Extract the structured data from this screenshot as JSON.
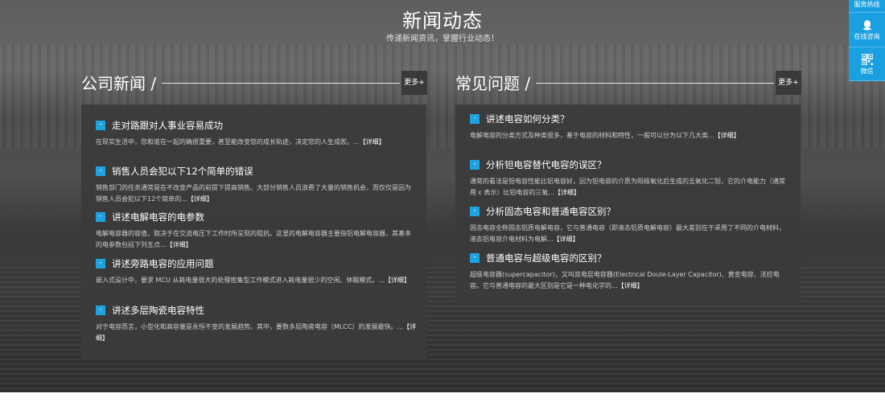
{
  "header": {
    "title": "新闻动态",
    "subtitle": "传递新闻资讯，掌握行业动态！"
  },
  "company_news": {
    "title": "公司新闻",
    "slash": "/",
    "more": "更多+",
    "badge": "-",
    "items": [
      {
        "title": "走对路跟对人事业容易成功",
        "desc": "在现实生活中，您和谁在一起的确很重要，甚至能改变您的成长轨迹，决定您的人生成败。...",
        "detail": "【详细】"
      },
      {
        "title": "销售人员会犯以下12个简单的错误",
        "desc": "销售部门的任务通常是在不改变产品的前提下提高销售。大部分销售人员浪费了大量的销售机会，而仅仅是因为销售人员会犯以下12个简单的...",
        "detail": "【详细】"
      },
      {
        "title": "讲述电解电容的电参数",
        "desc": "电解电容器的容值，取决于在交流电压下工作时所呈现的阻抗。这里的电解电容器主要指铝电解电容器，其基本的电参数包括下列五点...",
        "detail": "【详细】"
      },
      {
        "title": "讲述旁路电容的应用问题",
        "desc": "嵌入式设计中，要求 MCU 从耗电量很大的处理密集型工作模式进入耗电量很少的空闲、休眠模式。...",
        "detail": "【详细】"
      },
      {
        "title": "讲述多层陶瓷电容特性",
        "desc": "对于电容而言，小型化和高容量是永恒不变的发展趋势。其中，要数多层陶瓷电容（MLCC）的发展最快。...",
        "detail": "【详细】"
      }
    ]
  },
  "faq": {
    "title": "常见问题",
    "slash": "/",
    "more": "更多+",
    "badge": "-",
    "items": [
      {
        "title": "讲述电容如何分类？",
        "desc": "电解电容的分类方式及种类很多，基于电容的材料和特性，一般可以分为以下几大类...",
        "detail": "【详细】"
      },
      {
        "title": "分析钽电容替代电容的误区？",
        "desc": "通常的看法是钽电容性能比铝电容好，因为钽电容的介质为阳极氧化后生成的五氧化二钽，它的介电能力（通常用 ε 表示）比铝电容的三氧...",
        "detail": "【详细】"
      },
      {
        "title": "分析固态电容和普通电容区别？",
        "desc": "固态电容全称固态铝质电解电容，它与普通电容（即液态铝质电解电容）最大差别在于采用了不同的介电材料，液态铝电容介电材料为电解...",
        "detail": "【详细】"
      },
      {
        "title": "普通电容与超级电容的区别？",
        "desc": "超级电容器(supercapacitor)，又叫双电层电容器(Electrical Doule-Layer Capacitor)、黄金电容、法拉电容。它与普通电容的最大区别是它是一种电化学的...",
        "detail": "【详细】"
      }
    ]
  },
  "side_bar": {
    "hotline": "服务热线",
    "online": "在线咨询",
    "wechat": "微信"
  },
  "colors": {
    "accent": "#1aa0e0",
    "panel": "#3a3a3a"
  }
}
